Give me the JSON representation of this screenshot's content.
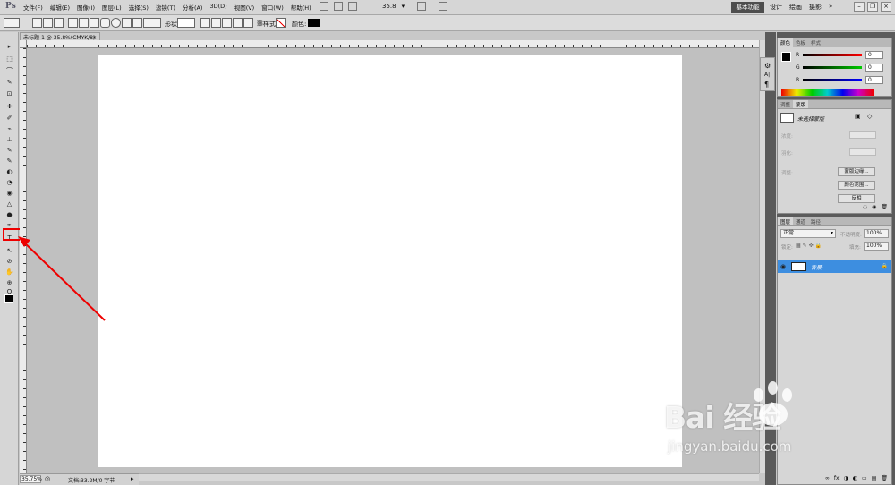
{
  "app": {
    "logo": "Ps"
  },
  "menu": [
    "文件(F)",
    "编辑(E)",
    "图像(I)",
    "图层(L)",
    "选择(S)",
    "滤镜(T)",
    "分析(A)",
    "3D(D)",
    "视图(V)",
    "窗口(W)",
    "帮助(H)"
  ],
  "view_zoom": "35.8",
  "workspaces": {
    "active": "基本功能",
    "others": [
      "设计",
      "绘画",
      "摄影",
      "»"
    ]
  },
  "options": {
    "shape_label": "形状:",
    "style_label": "样式:",
    "color_label": "颜色:",
    "color_value": "#000000"
  },
  "document": {
    "tab_title": "未标题-1 @ 35.8%(CMYK/8)",
    "close": "×"
  },
  "status": {
    "zoom": "35.75%",
    "info": "文档:33.2M/0 字节"
  },
  "tools": [
    "▸",
    "⬚",
    "⌒",
    "✎",
    "⊡",
    "✜",
    "✐",
    "⌁",
    "⊥",
    "✎",
    "✎",
    "◐",
    "◔",
    "◉",
    "△",
    "●",
    "✒",
    "T",
    "↖",
    "⊘",
    "✋",
    "⊕",
    "Q"
  ],
  "mini_panel": [
    "⚙",
    "A|",
    "¶"
  ],
  "color_panel": {
    "tabs": [
      "颜色",
      "色板",
      "样式"
    ],
    "channels": [
      {
        "label": "R",
        "value": "0",
        "color": "#d01010"
      },
      {
        "label": "G",
        "value": "0",
        "color": "#10a010"
      },
      {
        "label": "B",
        "value": "0",
        "color": "#1020d0"
      }
    ]
  },
  "mask_panel": {
    "tabs": [
      "调整",
      "蒙版"
    ],
    "status": "未选择蒙版",
    "density_label": "浓度:",
    "feather_label": "羽化:",
    "refine_label": "调整:",
    "buttons": [
      "蒙版边缘...",
      "颜色范围...",
      "反相"
    ]
  },
  "layers_panel": {
    "tabs": [
      "图层",
      "通道",
      "路径"
    ],
    "blend_mode": "正常",
    "opacity_label": "不透明度:",
    "opacity_value": "100%",
    "lock_label": "锁定:",
    "fill_label": "填充:",
    "fill_value": "100%",
    "layer_name": "背景",
    "footer_icons": [
      "∞",
      "fx",
      "◑",
      "◐",
      "▭",
      "▤",
      "🗑"
    ]
  },
  "watermark": {
    "main": "Bai 经验",
    "sub": "jingyan.baidu.com"
  }
}
